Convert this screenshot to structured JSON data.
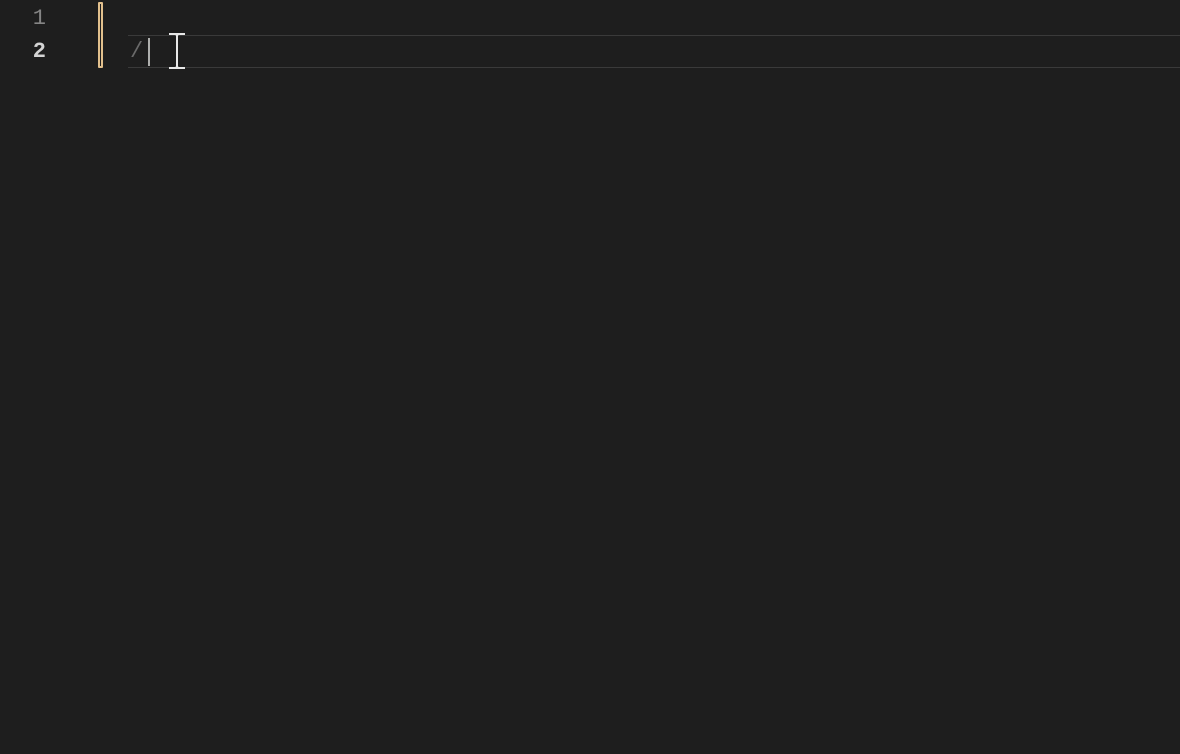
{
  "editor": {
    "lines": [
      {
        "number": "1",
        "content": "",
        "active": false
      },
      {
        "number": "2",
        "content": "/",
        "active": true
      }
    ]
  },
  "colors": {
    "background": "#1e1e1e",
    "gutter_inactive": "#858585",
    "gutter_active": "#d4d4d4",
    "modified_indicator": "#e2c08d",
    "text": "#6a6a6a",
    "caret": "#aeafad",
    "active_border": "#3a3a3a"
  }
}
